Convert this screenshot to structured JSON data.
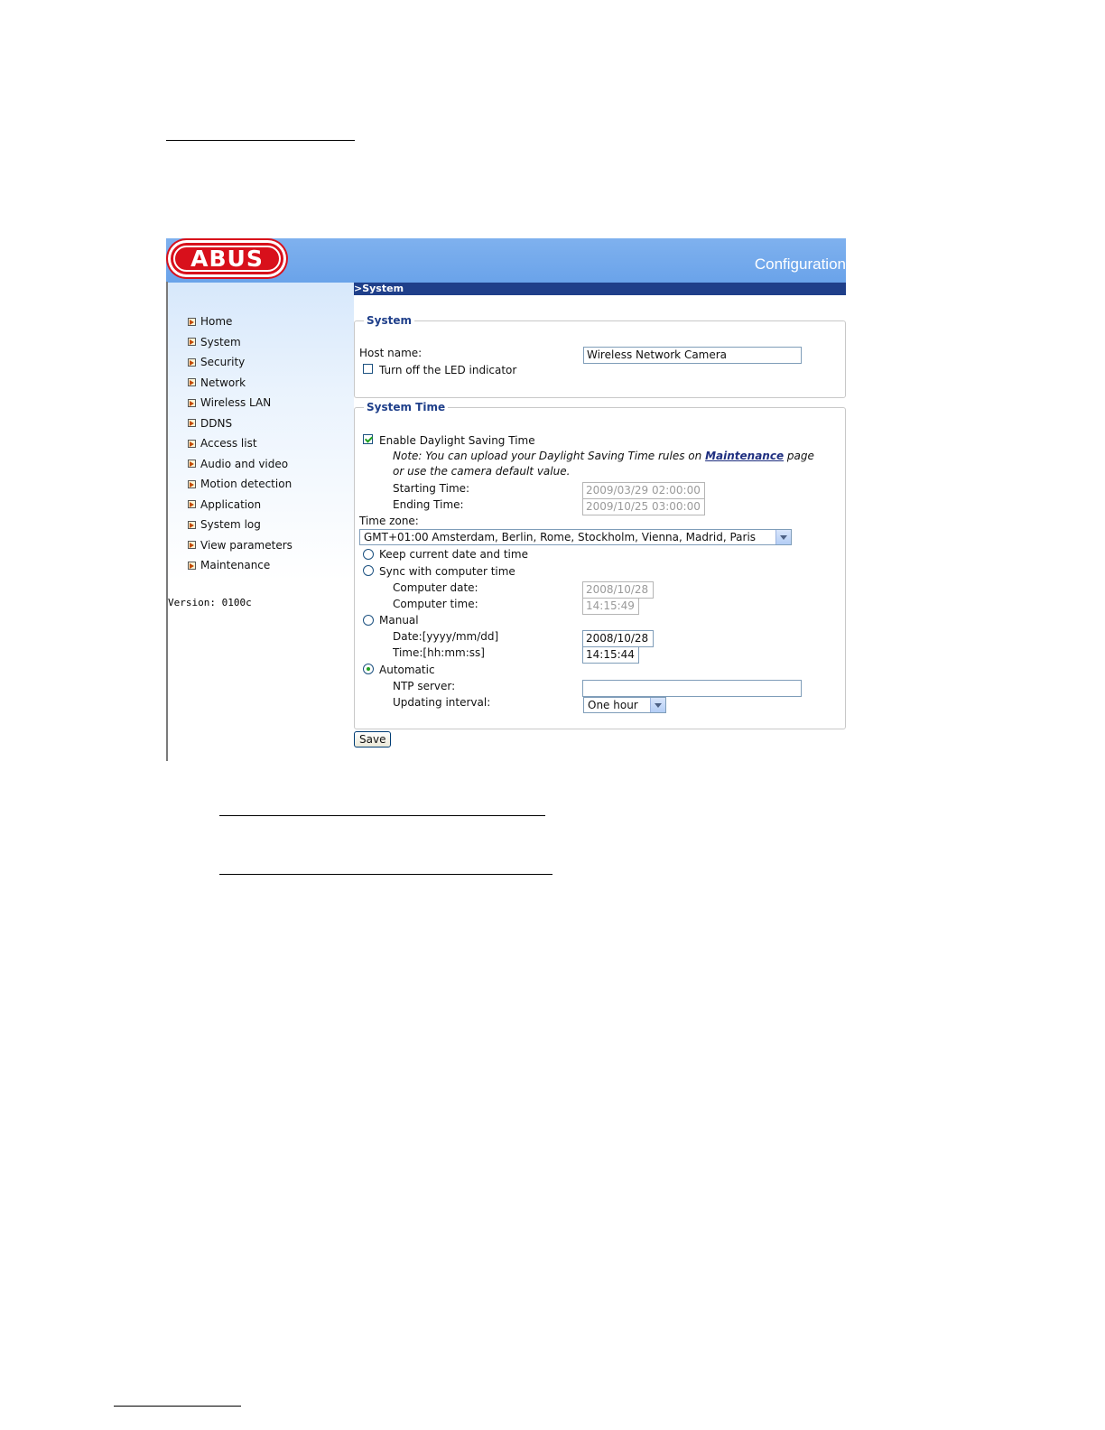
{
  "app": {
    "logo_text": "ABUS",
    "title": "Configuration"
  },
  "sidebar": {
    "items": [
      {
        "label": "Home"
      },
      {
        "label": "System"
      },
      {
        "label": "Security"
      },
      {
        "label": "Network"
      },
      {
        "label": "Wireless LAN"
      },
      {
        "label": "DDNS"
      },
      {
        "label": "Access list"
      },
      {
        "label": "Audio and video"
      },
      {
        "label": "Motion detection"
      },
      {
        "label": "Application"
      },
      {
        "label": "System log"
      },
      {
        "label": "View parameters"
      },
      {
        "label": "Maintenance"
      }
    ],
    "version": "Version: 0100c"
  },
  "page": {
    "section_title": ">System"
  },
  "system": {
    "legend": "System",
    "host_name_label": "Host name:",
    "host_name_value": "Wireless Network Camera",
    "led_label": "Turn off the LED indicator",
    "led_checked": false
  },
  "time": {
    "legend": "System Time",
    "dst_label": "Enable Daylight Saving Time",
    "dst_checked": true,
    "note_prefix": "Note: You can upload your Daylight Saving Time rules on ",
    "note_link": "Maintenance",
    "note_suffix": " page or use the camera default value.",
    "start_label": "Starting Time:",
    "start_value": "2009/03/29 02:00:00",
    "end_label": "Ending Time:",
    "end_value": "2009/10/25 03:00:00",
    "tz_label": "Time zone:",
    "tz_value": "GMT+01:00 Amsterdam, Berlin, Rome, Stockholm, Vienna, Madrid, Paris",
    "opt_keep": "Keep current date and time",
    "opt_sync": "Sync with computer time",
    "comp_date_label": "Computer date:",
    "comp_date_value": "2008/10/28",
    "comp_time_label": "Computer time:",
    "comp_time_value": "14:15:49",
    "opt_manual": "Manual",
    "date_label": "Date:[yyyy/mm/dd]",
    "date_value": "2008/10/28",
    "time_label": "Time:[hh:mm:ss]",
    "time_value": "14:15:44",
    "opt_auto": "Automatic",
    "selected_option": "Automatic",
    "ntp_label": "NTP server:",
    "ntp_value": "",
    "interval_label": "Updating interval:",
    "interval_value": "One hour"
  },
  "actions": {
    "save_label": "Save"
  }
}
